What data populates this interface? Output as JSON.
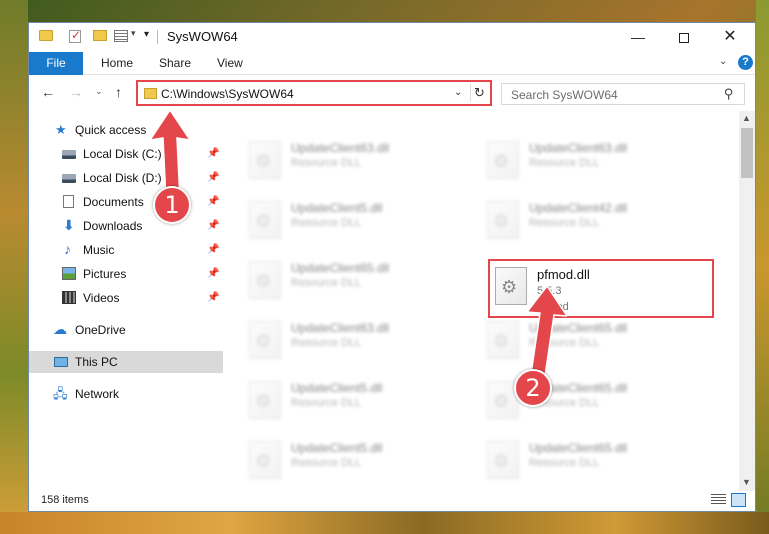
{
  "window": {
    "title": "SysWOW64",
    "minimize_glyph": "—",
    "close_glyph": "✕"
  },
  "ribbon": {
    "file": "File",
    "home": "Home",
    "share": "Share",
    "view": "View",
    "help_glyph": "?"
  },
  "address": {
    "path": "C:\\Windows\\SysWOW64",
    "search_placeholder": "Search SysWOW64"
  },
  "sidebar": {
    "items": [
      {
        "label": "Quick access",
        "pinned": false
      },
      {
        "label": "Local Disk (C:)",
        "pinned": true
      },
      {
        "label": "Local Disk (D:)",
        "pinned": true
      },
      {
        "label": "Documents",
        "pinned": true
      },
      {
        "label": "Downloads",
        "pinned": true
      },
      {
        "label": "Music",
        "pinned": true
      },
      {
        "label": "Pictures",
        "pinned": true
      },
      {
        "label": "Videos",
        "pinned": true
      },
      {
        "label": "OneDrive",
        "pinned": false
      },
      {
        "label": "This PC",
        "pinned": false,
        "selected": true
      },
      {
        "label": "Network",
        "pinned": false
      }
    ]
  },
  "files": {
    "left": [
      {
        "name": "UpdateClient63.dll",
        "type": "Resource DLL"
      },
      {
        "name": "UpdateClient5.dll",
        "type": "Resource DLL"
      },
      {
        "name": "UpdateClient65.dll",
        "type": "Resource DLL"
      },
      {
        "name": "UpdateClient63.dll",
        "type": "Resource DLL"
      },
      {
        "name": "UpdateClient5.dll",
        "type": "Resource DLL"
      },
      {
        "name": "UpdateClient5.dll",
        "type": "Resource DLL"
      }
    ],
    "right": [
      {
        "name": "UpdateClient63.dll",
        "type": "Resource DLL"
      },
      {
        "name": "UpdateClient42.dll",
        "type": "Resource DLL"
      },
      {
        "name": "UpdateClient65.dll",
        "type": "Resource DLL"
      },
      {
        "name": "UpdateClient65.dll",
        "type": "Resource DLL"
      },
      {
        "name": "UpdateClient65.dll",
        "type": "Resource DLL"
      }
    ],
    "highlighted": {
      "name": "pfmod.dll",
      "version": "5.5.3",
      "description": "PfMod"
    }
  },
  "status": {
    "item_count": "158 items"
  },
  "callouts": {
    "one": "1",
    "two": "2"
  },
  "colors": {
    "accent": "#1979ca",
    "highlight": "#e4474b"
  }
}
